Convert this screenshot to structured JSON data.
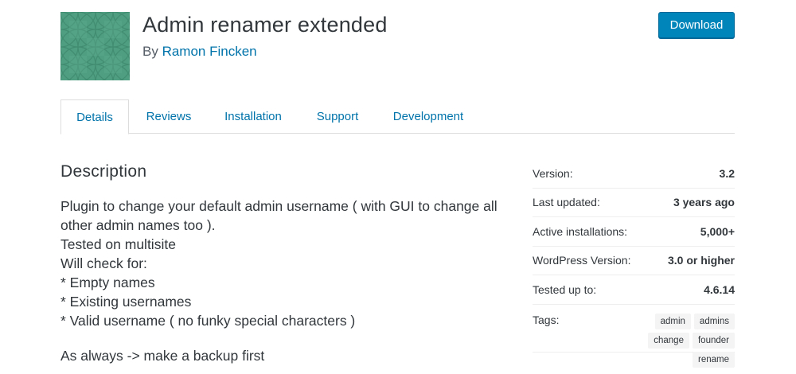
{
  "plugin": {
    "title": "Admin renamer extended",
    "by_prefix": "By ",
    "author": "Ramon Fincken",
    "download_label": "Download",
    "icon": "plugin-banner-icon",
    "icon_color": "#4f9e82"
  },
  "tabs": [
    {
      "label": "Details",
      "active": true
    },
    {
      "label": "Reviews",
      "active": false
    },
    {
      "label": "Installation",
      "active": false
    },
    {
      "label": "Support",
      "active": false
    },
    {
      "label": "Development",
      "active": false
    }
  ],
  "description": {
    "heading": "Description",
    "lines": [
      "Plugin to change your default admin username ( with GUI to change all other admin names too ).",
      "Tested on multisite",
      "Will check for:",
      "* Empty names",
      "* Existing usernames",
      "* Valid username ( no funky special characters )"
    ],
    "footer": "As always -> make a backup first"
  },
  "meta": {
    "version_label": "Version:",
    "version": "3.2",
    "updated_label": "Last updated:",
    "updated": "3 years ago",
    "installs_label": "Active installations:",
    "installs": "5,000+",
    "wp_label": "WordPress Version:",
    "wp": "3.0 or higher",
    "tested_label": "Tested up to:",
    "tested": "4.6.14",
    "tags_label": "Tags:",
    "tags": [
      "admin",
      "admins",
      "change",
      "founder",
      "rename"
    ]
  },
  "colors": {
    "link": "#0073aa",
    "button": "#0085ba"
  }
}
